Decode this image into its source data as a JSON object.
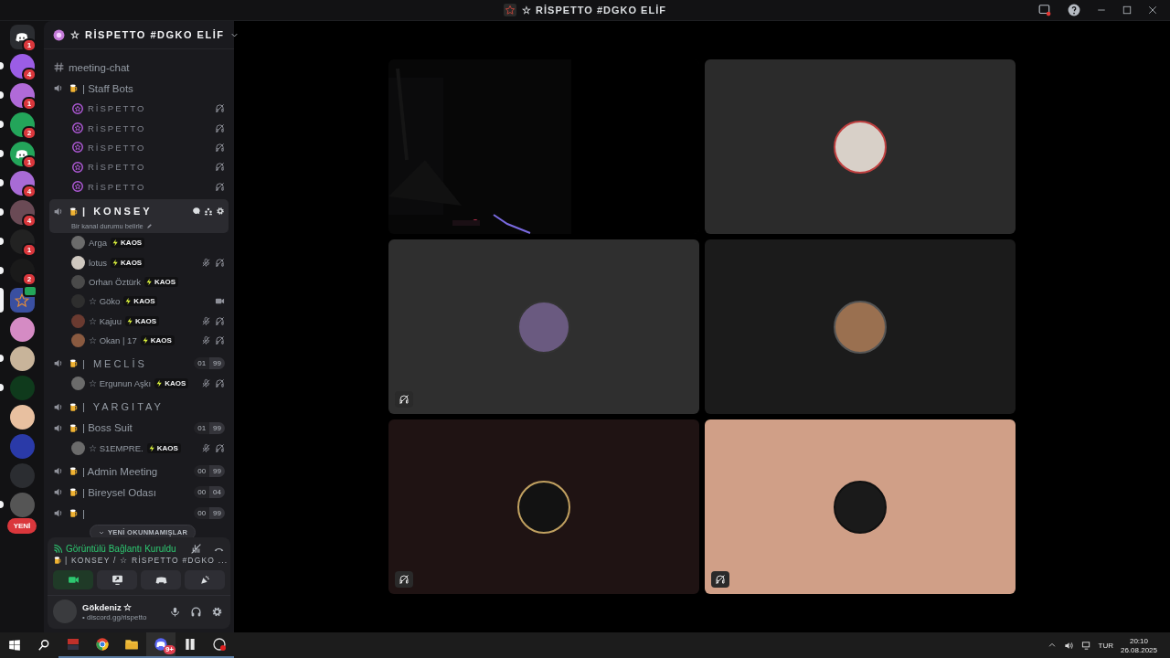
{
  "window": {
    "title": "☆ RİSPETTO #DGKO ELİF"
  },
  "rail": [
    {
      "kind": "home",
      "badge": "1",
      "unread": false,
      "selected": false
    },
    {
      "kind": "server",
      "badge": "4",
      "unread": true,
      "selected": false
    },
    {
      "kind": "server",
      "badge": "1",
      "unread": true,
      "selected": false
    },
    {
      "kind": "server",
      "badge": "2",
      "unread": true,
      "selected": false
    },
    {
      "kind": "home",
      "badge": "1",
      "unread": true,
      "selected": false
    },
    {
      "kind": "server",
      "badge": "4",
      "unread": true,
      "selected": false
    },
    {
      "kind": "server",
      "badge": "4",
      "unread": true,
      "selected": false
    },
    {
      "kind": "server",
      "badge": "1",
      "unread": true,
      "selected": false
    },
    {
      "kind": "server",
      "badge": "2",
      "unread": true,
      "selected": false
    },
    {
      "kind": "server",
      "unread": false,
      "selected": true,
      "video": true
    },
    {
      "kind": "server",
      "unread": false,
      "selected": false
    },
    {
      "kind": "server",
      "unread": true,
      "selected": false
    },
    {
      "kind": "server",
      "unread": true,
      "selected": false
    },
    {
      "kind": "server",
      "unread": false,
      "selected": false
    },
    {
      "kind": "server",
      "unread": false,
      "selected": false
    },
    {
      "kind": "server",
      "unread": false,
      "selected": false
    },
    {
      "kind": "server",
      "unread": true,
      "selected": false
    }
  ],
  "rail_new": "YENİ",
  "server": {
    "name": "☆ RİSPETTO #DGKO ELİF"
  },
  "channels": [
    {
      "kind": "text",
      "name": "meeting-chat",
      "selected": false
    },
    {
      "kind": "voice",
      "name": "| Staff Bots",
      "spaced": false,
      "selected": false,
      "members": [
        {
          "kind": "bot",
          "name": "RİSPETTO",
          "muted": false,
          "deafened": true,
          "video": false
        },
        {
          "kind": "bot",
          "name": "RİSPETTO",
          "muted": false,
          "deafened": true,
          "video": false
        },
        {
          "kind": "bot",
          "name": "RİSPETTO",
          "muted": false,
          "deafened": true,
          "video": false
        },
        {
          "kind": "bot",
          "name": "RİSPETTO",
          "muted": false,
          "deafened": true,
          "video": false
        },
        {
          "kind": "bot",
          "name": "RİSPETTO",
          "muted": false,
          "deafened": true,
          "video": false
        }
      ]
    },
    {
      "kind": "voice",
      "name": "| KONSEY",
      "spaced": true,
      "selected": true,
      "status": "Bir kanal durumu belirle",
      "members": [
        {
          "kind": "user",
          "name": "Arga",
          "tag": "KAOS",
          "muted": false,
          "deafened": false,
          "video": false
        },
        {
          "kind": "user",
          "name": "lotus",
          "tag": "KAOS",
          "muted": true,
          "deafened": true,
          "video": false
        },
        {
          "kind": "user",
          "name": "Orhan Öztürk",
          "tag": "KAOS",
          "muted": false,
          "deafened": false,
          "video": false
        },
        {
          "kind": "user",
          "name": "☆ Göko",
          "tag": "KAOS",
          "muted": false,
          "deafened": false,
          "video": true
        },
        {
          "kind": "user",
          "name": "☆ Kajuu",
          "tag": "KAOS",
          "muted": true,
          "deafened": true,
          "video": false
        },
        {
          "kind": "user",
          "name": "☆ Okan | 17",
          "tag": "KAOS",
          "muted": true,
          "deafened": true,
          "video": false
        }
      ]
    },
    {
      "kind": "voice",
      "name": "| MECLİS",
      "spaced": true,
      "selected": false,
      "count": "01",
      "limit": "99",
      "members": [
        {
          "kind": "user",
          "name": "☆ Ergunun Aşkı",
          "tag": "KAOS",
          "muted": true,
          "deafened": true,
          "video": false
        }
      ]
    },
    {
      "kind": "voice",
      "name": "| YARGITAY",
      "spaced": true,
      "selected": false
    },
    {
      "kind": "voice",
      "name": "| Boss Suit",
      "spaced": false,
      "selected": false,
      "count": "01",
      "limit": "99",
      "members": [
        {
          "kind": "user",
          "name": "☆ S1EMPRE.",
          "tag": "KAOS",
          "muted": true,
          "deafened": true,
          "video": false
        }
      ]
    },
    {
      "kind": "voice",
      "name": "| Admin Meeting",
      "spaced": false,
      "selected": false,
      "count": "00",
      "limit": "99"
    },
    {
      "kind": "voice",
      "name": "| Bireysel Odası",
      "spaced": false,
      "selected": false,
      "count": "00",
      "limit": "04"
    },
    {
      "kind": "voice",
      "name": "|",
      "spaced": false,
      "selected": false,
      "count": "00",
      "limit": "99"
    }
  ],
  "unread_popup": "YENİ OKUNMAMIŞLAR",
  "voice_panel": {
    "status": "Görüntülü Bağlantı Kuruldu",
    "location": "| KONSEY / ☆ RİSPETTO #DGKO ...",
    "camera_on": true
  },
  "user": {
    "name": "Gökdeniz ☆",
    "status": "• discord.gg/rispetto"
  },
  "tiles": [
    {
      "kind": "screen",
      "deafened": false
    },
    {
      "kind": "avatar",
      "color": "#2b2b2b",
      "deafened": false
    },
    {
      "kind": "avatar",
      "color": "#2f2f2f",
      "deafened": true
    },
    {
      "kind": "avatar",
      "color": "#1b1b1b",
      "deafened": false
    },
    {
      "kind": "avatar",
      "color": "#1f1313",
      "deafened": true
    },
    {
      "kind": "avatar",
      "color": "#d09f87",
      "deafened": true
    }
  ],
  "taskbar": {
    "apps": [
      {
        "kind": "voicemeeter",
        "selected": false
      },
      {
        "kind": "chrome",
        "selected": false
      },
      {
        "kind": "folder",
        "selected": false
      },
      {
        "kind": "discord",
        "selected": true,
        "badge": "9+"
      },
      {
        "kind": "app",
        "selected": false
      },
      {
        "kind": "recorder",
        "selected": false
      }
    ],
    "language": "TUR",
    "time": "20:10",
    "date": "26.08.2025"
  }
}
